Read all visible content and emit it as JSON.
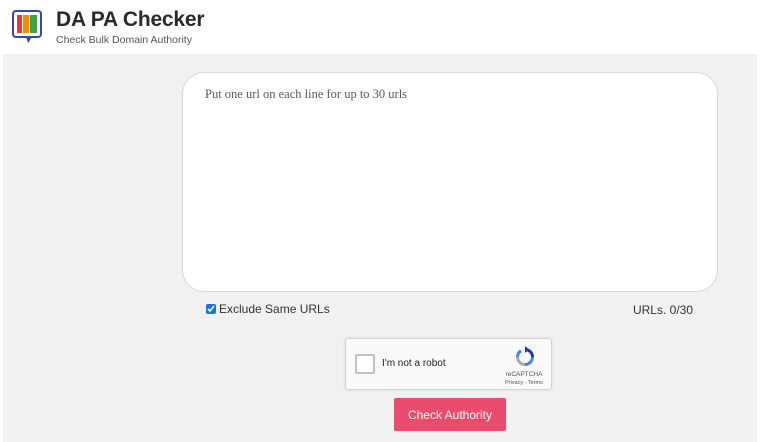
{
  "header": {
    "title": "DA PA Checker",
    "subtitle": "Check Bulk Domain Authority",
    "logo_icon": "da-pa-checker-logo-icon"
  },
  "form": {
    "textarea_placeholder": "Put one url on each line for up to 30 urls",
    "textarea_value": "",
    "exclude_label": "Exclude Same URLs",
    "exclude_checked": true,
    "url_count": "URLs. 0/30"
  },
  "recaptcha": {
    "label": "I'm not a robot",
    "brand": "reCAPTCHA",
    "terms": "Privacy - Terms",
    "checked": false
  },
  "actions": {
    "check_button_label": "Check Authority"
  },
  "colors": {
    "accent": "#ea4c6d",
    "background": "#f1f1f1",
    "logo_red": "#e53935",
    "logo_orange": "#fb8c00",
    "logo_green": "#43a047",
    "logo_blue": "#3949ab"
  }
}
